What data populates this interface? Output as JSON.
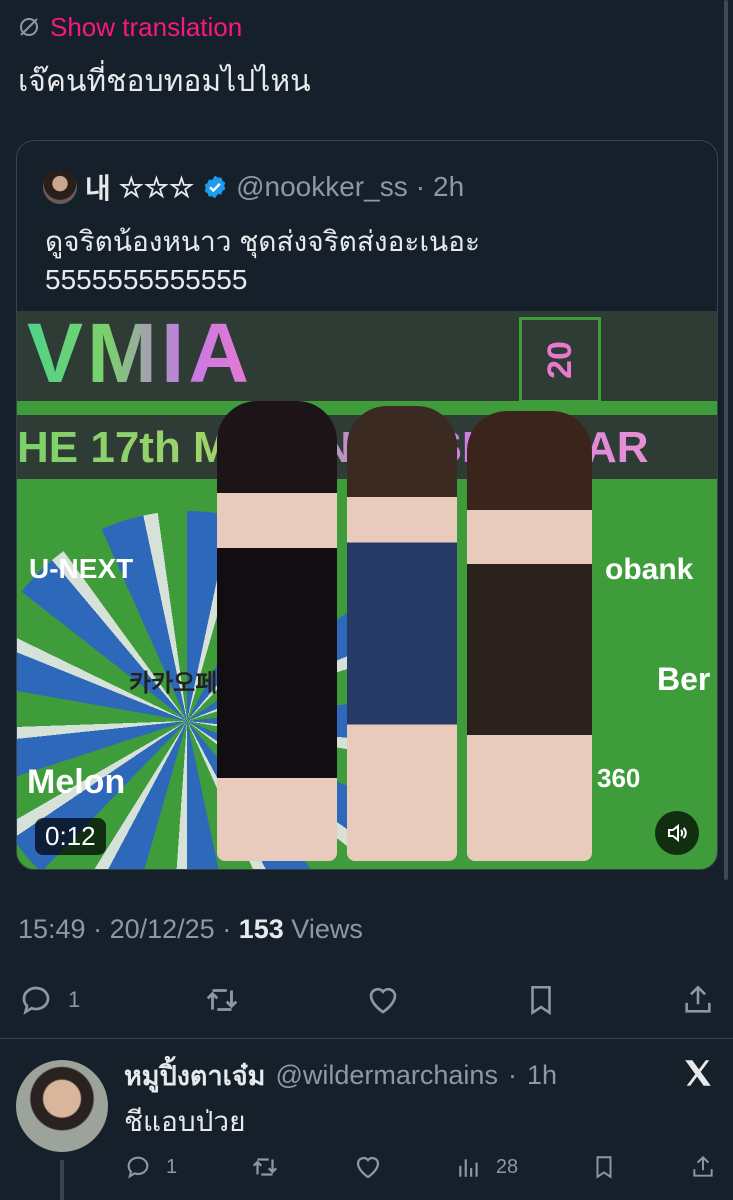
{
  "translation": {
    "label": "Show translation",
    "icon": "globe-off-icon"
  },
  "tweet": {
    "text": "เจ๊คนที่ชอบทอมไปไหน"
  },
  "quote": {
    "name": "내",
    "stars": "☆☆☆",
    "handle": "@nookker_ss",
    "time": "2h",
    "text_line1": "ดูจริตน้องหนาว ชุดส่งจริตส่งอะเนอะ",
    "text_line2": "5555555555555",
    "video": {
      "duration": "0:12",
      "banner_top": "VMIA",
      "banner_year": "20",
      "banner_mid": "HE 17th MELON MUSIC AWAR",
      "sponsors": [
        "U-NEXT",
        "obank",
        "카카오페",
        "Melon",
        "360",
        "Ber"
      ]
    }
  },
  "meta": {
    "time": "15:49",
    "date": "20/12/25",
    "views_count": "153",
    "views_label": "Views"
  },
  "actions": {
    "reply_count": "1"
  },
  "reply": {
    "name": "หมูปิ้งตาเจ๋ม",
    "handle": "@wildermarchains",
    "time": "1h",
    "text": "ชีแอบป่วย",
    "reply_count": "1",
    "views_count": "28"
  },
  "colors": {
    "accent_pink": "#f91880",
    "verified_blue": "#1d9bf0",
    "muted": "#8b98a5",
    "background": "#15202b"
  }
}
